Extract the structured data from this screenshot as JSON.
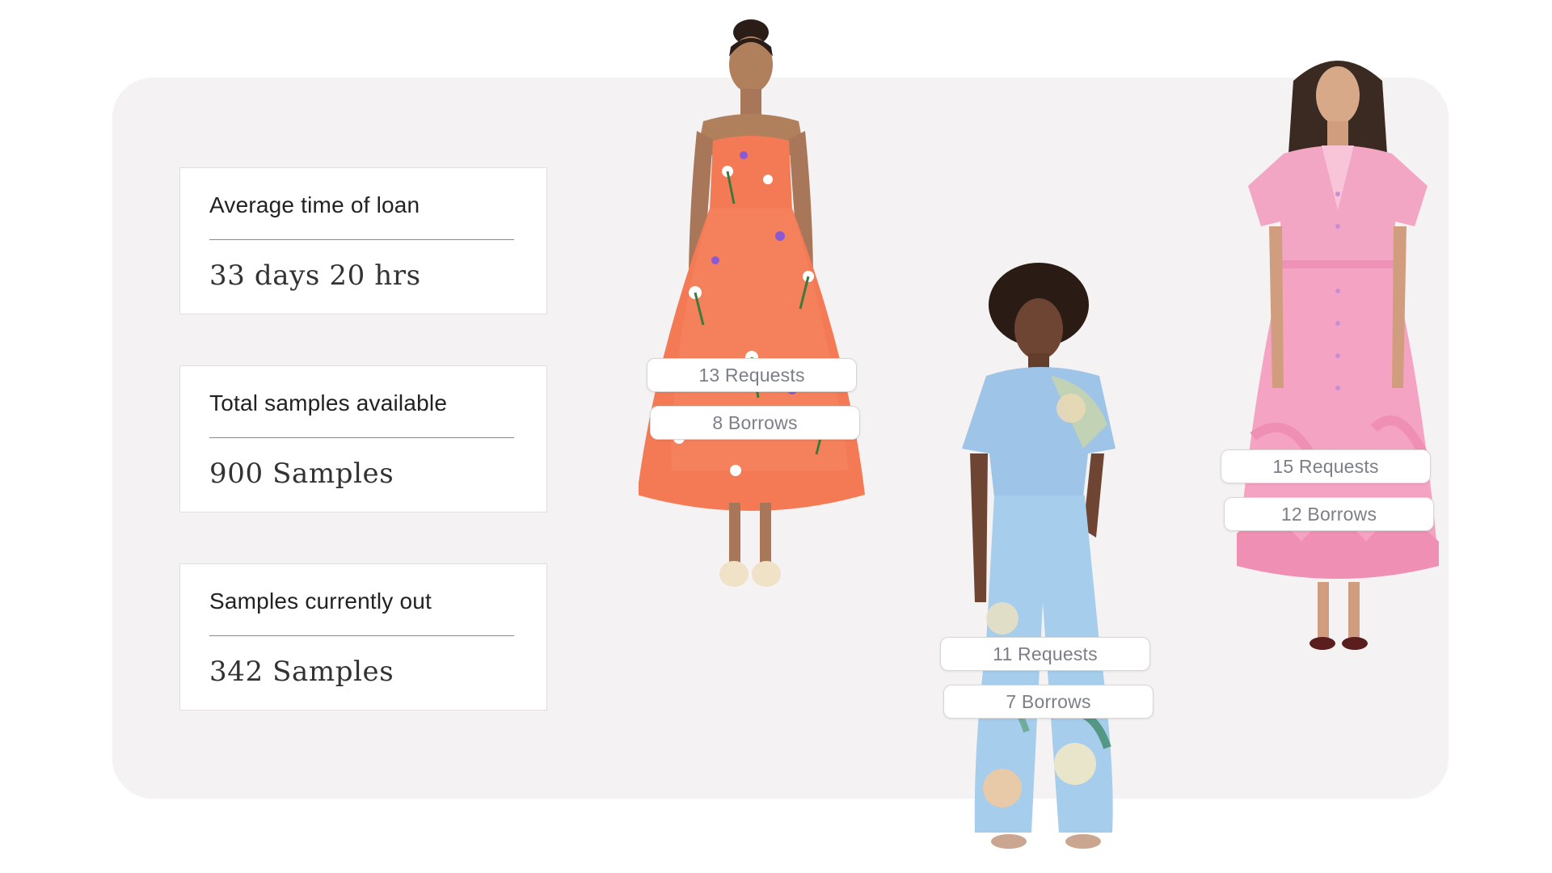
{
  "stats": [
    {
      "label": "Average time of loan",
      "value": "33 days 20 hrs"
    },
    {
      "label": "Total samples available",
      "value": "900 Samples"
    },
    {
      "label": "Samples currently out",
      "value": "342 Samples"
    }
  ],
  "products": [
    {
      "name": "orange-floral-strapless-dress",
      "requests": "13 Requests",
      "borrows": "8 Borrows"
    },
    {
      "name": "blue-floral-jumpsuit",
      "requests": "11 Requests",
      "borrows": "7 Borrows"
    },
    {
      "name": "pink-shirt-dress",
      "requests": "15 Requests",
      "borrows": "12 Borrows"
    }
  ],
  "colors": {
    "panel_background": "#f4f2f2",
    "card_border": "#e2dede",
    "pill_text": "#7c7f88",
    "orange_dress": "#f47a55",
    "blue_jumpsuit": "#9cc8ec",
    "pink_dress": "#f5a3c2"
  }
}
